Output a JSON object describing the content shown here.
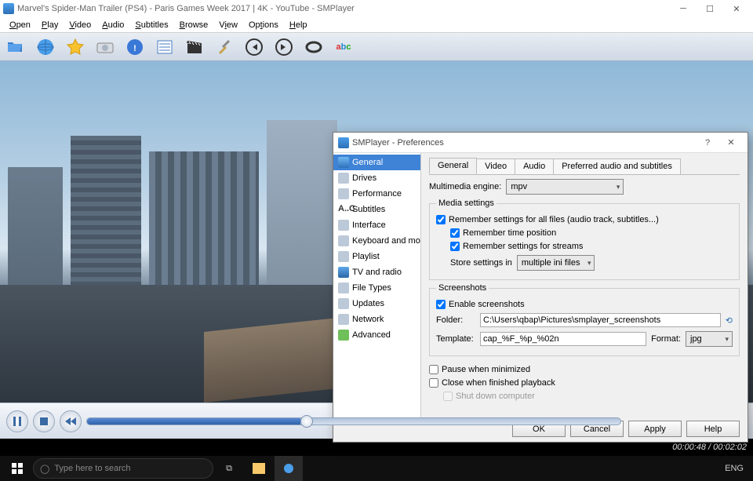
{
  "window_title": "Marvel's Spider-Man Trailer (PS4) - Paris Games Week 2017 | 4K - YouTube - SMPlayer",
  "menus": [
    "Open",
    "Play",
    "Video",
    "Audio",
    "Subtitles",
    "Browse",
    "View",
    "Options",
    "Help"
  ],
  "status_time": "00:00:48 / 00:02:02",
  "taskbar": {
    "search_placeholder": "Type here to search",
    "lang": "ENG"
  },
  "prefs": {
    "title": "SMPlayer - Preferences",
    "nav": [
      "General",
      "Drives",
      "Performance",
      "Subtitles",
      "Interface",
      "Keyboard and mouse",
      "Playlist",
      "TV and radio",
      "File Types",
      "Updates",
      "Network",
      "Advanced"
    ],
    "nav_prefix_subtitles": "A..C",
    "tabs": [
      "General",
      "Video",
      "Audio",
      "Preferred audio and subtitles"
    ],
    "engine_label": "Multimedia engine:",
    "engine_value": "mpv",
    "media_legend": "Media settings",
    "remember_all": "Remember settings for all files (audio track, subtitles...)",
    "remember_time": "Remember time position",
    "remember_streams": "Remember settings for streams",
    "store_label": "Store settings in",
    "store_value": "multiple ini files",
    "screenshots_legend": "Screenshots",
    "enable_ss": "Enable screenshots",
    "folder_label": "Folder:",
    "folder_value": "C:\\Users\\qbap\\Pictures\\smplayer_screenshots",
    "template_label": "Template:",
    "template_value": "cap_%F_%p_%02n",
    "format_label": "Format:",
    "format_value": "jpg",
    "pause_min": "Pause when minimized",
    "close_fin": "Close when finished playback",
    "shutdown": "Shut down computer",
    "buttons": [
      "OK",
      "Cancel",
      "Apply",
      "Help"
    ]
  }
}
